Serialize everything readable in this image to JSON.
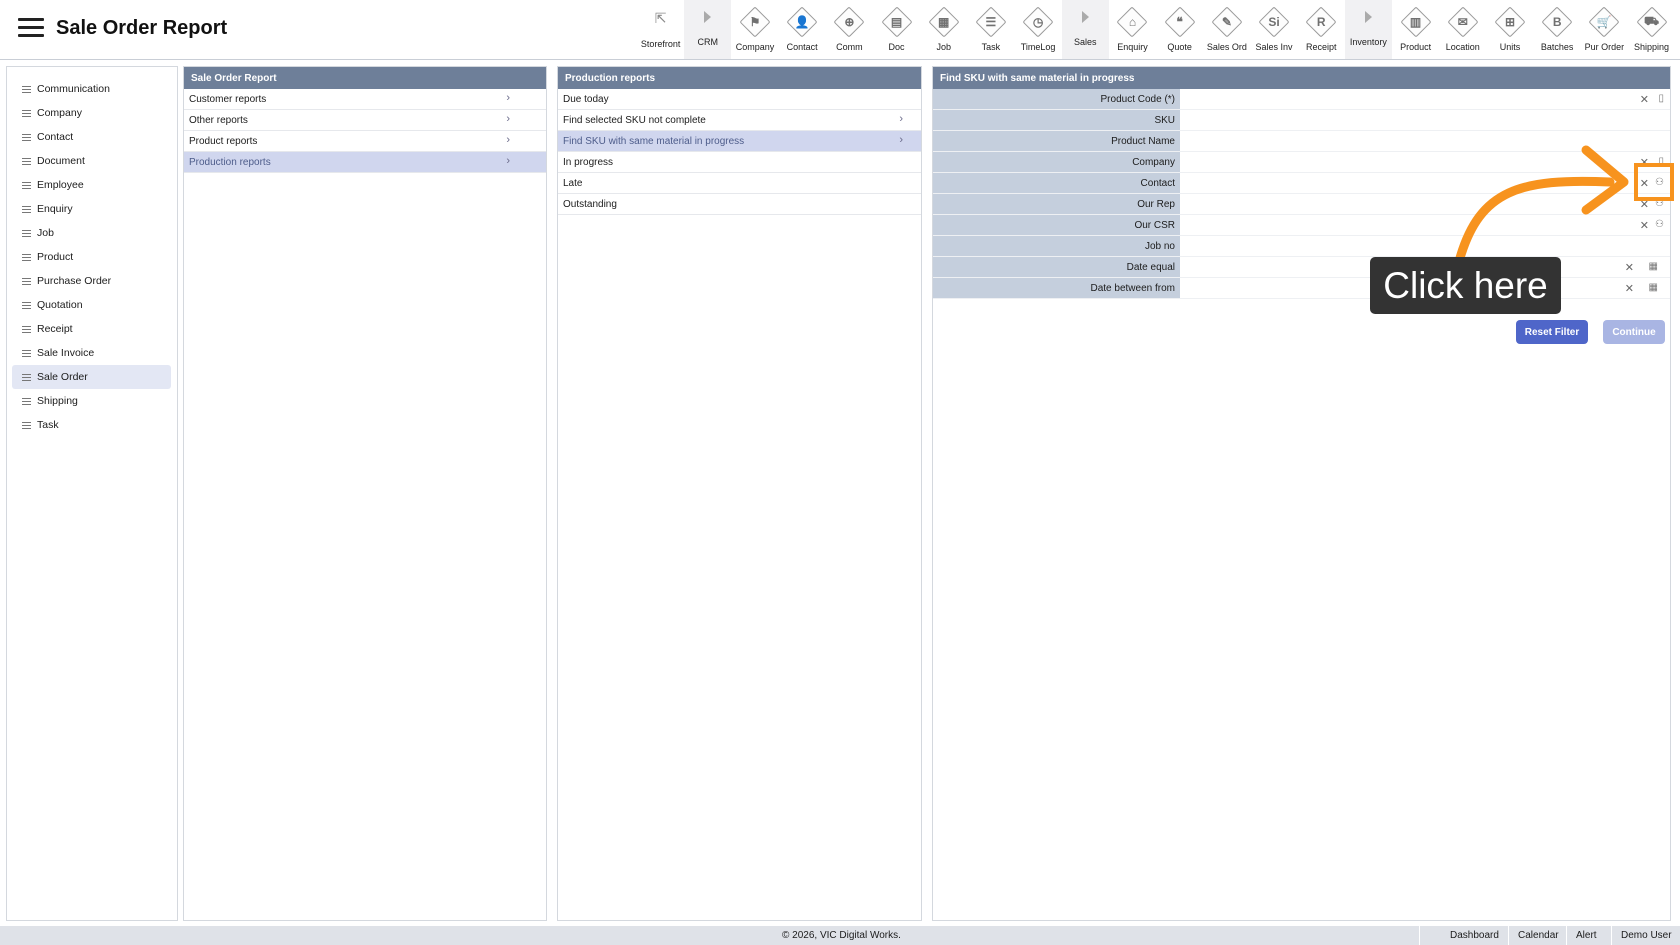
{
  "header": {
    "title": "Sale Order Report"
  },
  "toolbar": [
    {
      "label": "Storefront",
      "glyph": "⇱",
      "kind": "plain"
    },
    {
      "label": "CRM",
      "kind": "arrow",
      "shaded": true
    },
    {
      "label": "Company",
      "glyph": "⚑"
    },
    {
      "label": "Contact",
      "glyph": "👤"
    },
    {
      "label": "Comm",
      "glyph": "⊕"
    },
    {
      "label": "Doc",
      "glyph": "▤"
    },
    {
      "label": "Job",
      "glyph": "▦"
    },
    {
      "label": "Task",
      "glyph": "☰"
    },
    {
      "label": "TimeLog",
      "glyph": "◷"
    },
    {
      "label": "Sales",
      "kind": "arrow",
      "shaded": true
    },
    {
      "label": "Enquiry",
      "glyph": "⌂"
    },
    {
      "label": "Quote",
      "glyph": "❝"
    },
    {
      "label": "Sales Ord",
      "glyph": "✎"
    },
    {
      "label": "Sales Inv",
      "glyph": "Si"
    },
    {
      "label": "Receipt",
      "glyph": "R"
    },
    {
      "label": "Inventory",
      "kind": "arrow",
      "shaded": true
    },
    {
      "label": "Product",
      "glyph": "▥"
    },
    {
      "label": "Location",
      "glyph": "✉"
    },
    {
      "label": "Units",
      "glyph": "⊞"
    },
    {
      "label": "Batches",
      "glyph": "B"
    },
    {
      "label": "Pur Order",
      "glyph": "🛒"
    },
    {
      "label": "Shipping",
      "glyph": "⛟"
    }
  ],
  "nav": {
    "items": [
      "Communication",
      "Company",
      "Contact",
      "Document",
      "Employee",
      "Enquiry",
      "Job",
      "Product",
      "Purchase Order",
      "Quotation",
      "Receipt",
      "Sale Invoice",
      "Sale Order",
      "Shipping",
      "Task"
    ],
    "active": "Sale Order"
  },
  "col1": {
    "title": "Sale Order Report",
    "items": [
      "Customer reports",
      "Other reports",
      "Product reports",
      "Production reports"
    ],
    "selected": "Production reports"
  },
  "col2": {
    "title": "Production reports",
    "items": [
      {
        "label": "Due today",
        "chevron": false
      },
      {
        "label": "Find selected SKU not complete",
        "chevron": true
      },
      {
        "label": "Find SKU with same material in progress",
        "chevron": true
      },
      {
        "label": "In progress",
        "chevron": false
      },
      {
        "label": "Late",
        "chevron": false
      },
      {
        "label": "Outstanding",
        "chevron": false
      }
    ],
    "selected": "Find SKU with same material in progress"
  },
  "col3": {
    "title": "Find SKU with same material in progress",
    "fields": [
      {
        "label": "Product Code (*)",
        "clear": true,
        "icon": "clipboard-icon",
        "glyph": "▯"
      },
      {
        "label": "SKU",
        "clear": false,
        "icon": null
      },
      {
        "label": "Product Name",
        "clear": false,
        "icon": null
      },
      {
        "label": "Company",
        "clear": true,
        "icon": "clipboard-icon",
        "glyph": "▯"
      },
      {
        "label": "Contact",
        "clear": true,
        "icon": "person-icon",
        "glyph": "⚇"
      },
      {
        "label": "Our Rep",
        "clear": true,
        "icon": "person-icon",
        "glyph": "⚇"
      },
      {
        "label": "Our CSR",
        "clear": true,
        "icon": "person-icon",
        "glyph": "⚇"
      },
      {
        "label": "Job no",
        "clear": false,
        "icon": null
      },
      {
        "label": "Date equal",
        "clear": true,
        "icon": "calendar-icon",
        "glyph": "▦",
        "narrow": true
      },
      {
        "label": "Date between from",
        "clear": true,
        "icon": "calendar-icon",
        "glyph": "▦",
        "narrow": true
      }
    ],
    "reset_label": "Reset Filter",
    "continue_label": "Continue"
  },
  "annotation": {
    "text": "Click here",
    "color": "#f7931e"
  },
  "footer": {
    "copyright": "© 2026, VIC Digital Works.",
    "links": [
      "Dashboard",
      "Calendar",
      "Alert",
      "Demo User"
    ]
  }
}
